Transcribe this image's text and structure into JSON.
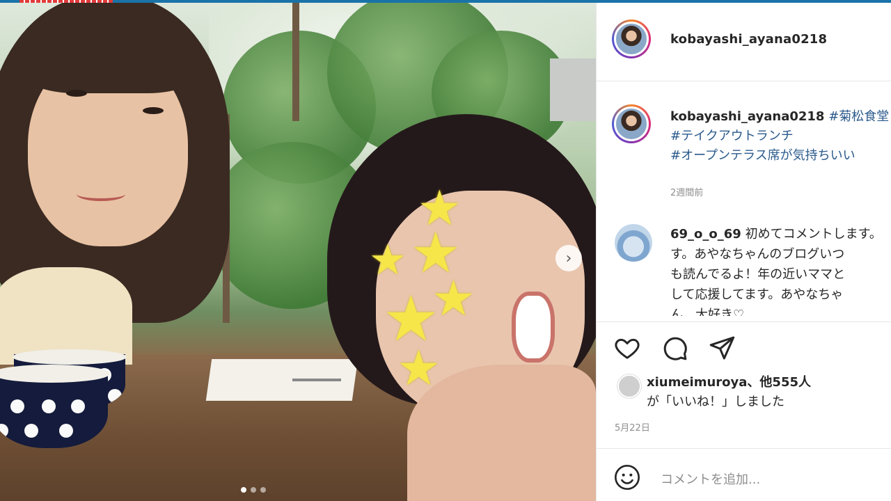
{
  "post": {
    "username": "kobayashi_ayana0218",
    "caption_user": "kobayashi_ayana0218",
    "caption_lines": [
      "#菊松食堂",
      "#テイクアウトランチ",
      "#オープンテラス席が気持ちいい"
    ],
    "caption_time": "2週間前",
    "comment_user": "69_o_o_69",
    "comment_text_lines": [
      "初めてコメントします。",
      "す。あやなちゃんのブログいつ",
      "も読んでるよ！年の近いママと",
      "して応援してます。あやなちゃ",
      "ん、大好き♡"
    ],
    "likes_user": "xiumeimuroya、他555人",
    "likes_suffix": "が「いいね！」しました",
    "date": "5月22日",
    "comment_placeholder": "コメントを追加..."
  },
  "carousel": {
    "next_label": "›",
    "slides": 3,
    "active": 1
  },
  "icons": [
    "heart-icon",
    "comment-icon",
    "share-icon",
    "emoji-icon",
    "chevron-right-icon"
  ],
  "colors": {
    "hashtag": "#2a5a8c",
    "text": "#262626",
    "muted": "#8e8e8e",
    "star": "#f6e64a"
  }
}
